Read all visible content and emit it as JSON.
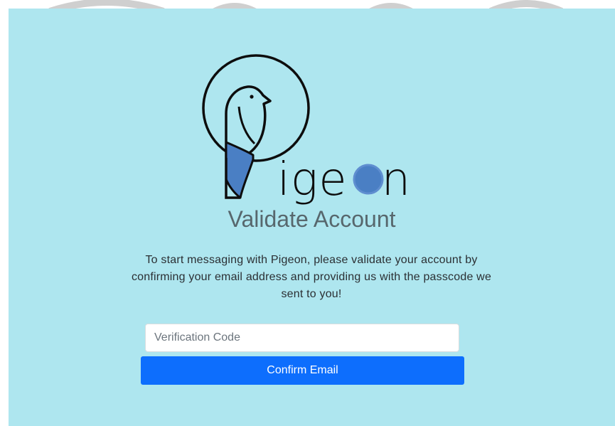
{
  "brand": {
    "name_tail": "ige",
    "name_end": "n",
    "accent_color": "#4a7fc4",
    "logo_icon": "pigeon-logo-icon"
  },
  "page": {
    "title": "Validate Account",
    "description": "To start messaging with Pigeon, please validate your account by confirming your email address and providing us with the passcode we sent to you!",
    "background_color": "#aee6ef"
  },
  "form": {
    "code_placeholder": "Verification Code",
    "code_value": "",
    "submit_label": "Confirm Email",
    "submit_color": "#0d6efd"
  }
}
